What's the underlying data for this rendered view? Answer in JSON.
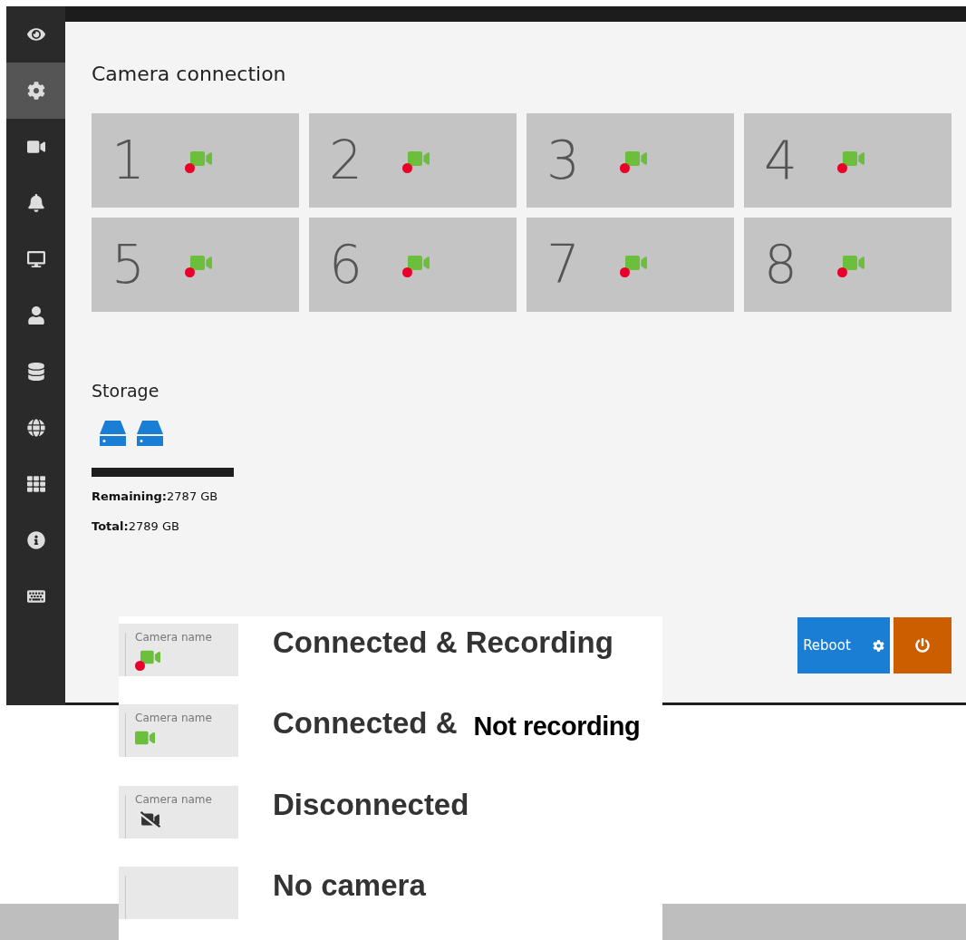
{
  "sidebar": {
    "items": [
      {
        "kind": "view",
        "selected": false
      },
      {
        "kind": "settings",
        "selected": true
      },
      {
        "kind": "camera",
        "selected": false
      },
      {
        "kind": "alarm",
        "selected": false
      },
      {
        "kind": "system",
        "selected": false
      },
      {
        "kind": "user",
        "selected": false
      },
      {
        "kind": "storage",
        "selected": false
      },
      {
        "kind": "network",
        "selected": false
      },
      {
        "kind": "apps",
        "selected": false
      },
      {
        "kind": "info",
        "selected": false
      },
      {
        "kind": "keyboard",
        "selected": false
      }
    ]
  },
  "camera_connection": {
    "title": "Camera connection",
    "cameras": [
      {
        "number": "1",
        "recording": true
      },
      {
        "number": "2",
        "recording": true
      },
      {
        "number": "3",
        "recording": true
      },
      {
        "number": "4",
        "recording": true
      },
      {
        "number": "5",
        "recording": true
      },
      {
        "number": "6",
        "recording": true
      },
      {
        "number": "7",
        "recording": true
      },
      {
        "number": "8",
        "recording": true
      }
    ]
  },
  "storage": {
    "title": "Storage",
    "remaining": "**Remaining:**2787 GB",
    "total": "**Total:**2789 GB"
  },
  "buttons": [
    {
      "kind": "reboot",
      "label": "Reboot"
    },
    {
      "kind": "power"
    }
  ],
  "legend": [
    {
      "kind": "recording",
      "camera_name": "Camera name",
      "label": "Connected & Recording"
    },
    {
      "kind": "connected",
      "camera_name": "Camera name",
      "label": "Connected &",
      "note": "Not recording"
    },
    {
      "kind": "disconnected",
      "camera_name": "Camera name",
      "label": "Disconnected"
    },
    {
      "kind": "none",
      "label": "No camera"
    }
  ]
}
